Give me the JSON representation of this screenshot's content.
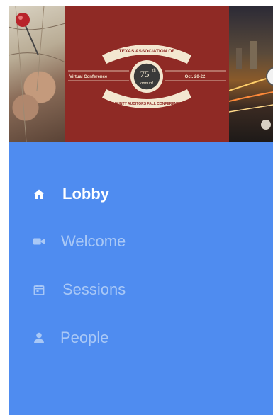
{
  "banner": {
    "org_line": "TEXAS ASSOCIATION OF",
    "left_text": "Virtual Conference",
    "right_text": "Oct. 20-22",
    "badge_number": "75",
    "badge_suffix": "th",
    "badge_word": "annual",
    "bottom_text": "COUNTY AUDITORS FALL CONFERENCE"
  },
  "nav": {
    "items": [
      {
        "label": "Lobby",
        "icon": "home-icon",
        "active": true
      },
      {
        "label": "Welcome",
        "icon": "video-icon",
        "active": false
      },
      {
        "label": "Sessions",
        "icon": "calendar-icon",
        "active": false
      },
      {
        "label": "People",
        "icon": "person-icon",
        "active": false
      }
    ]
  },
  "colors": {
    "nav_background": "#4f8cf0",
    "nav_active_text": "#ffffff",
    "nav_inactive_text": "#a9c8f6",
    "banner_red": "#8f2a25",
    "banner_cream": "#f3e7d0"
  }
}
